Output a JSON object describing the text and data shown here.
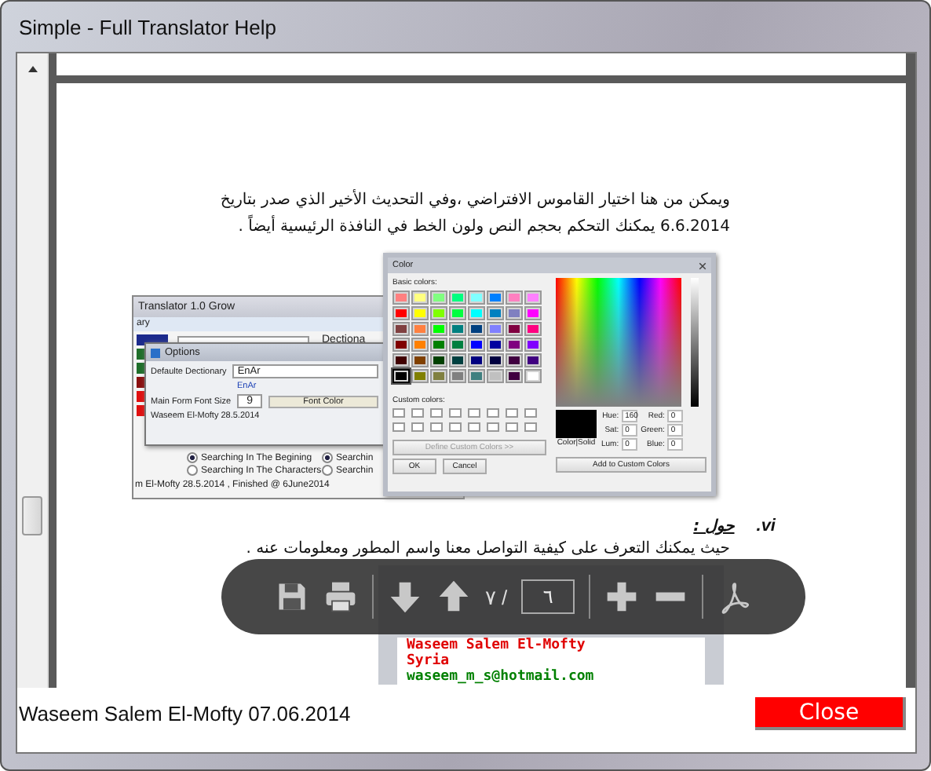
{
  "window": {
    "title": "Simple - Full Translator Help"
  },
  "document": {
    "intro_lines": [
      "ويمكن من هنا اختيار القاموس الافتراضي ،وفي التحديث الأخير الذي صدر بتاريخ",
      "6.6.2014 يمكنك التحكم بحجم النص ولون الخط في النافذة الرئيسية أيضاً ."
    ],
    "screenshot": {
      "main_window": {
        "title": "Translator 1.0 Grow",
        "menu_item": "ary",
        "side_buttons": [
          {
            "color": "#1c2a8c"
          },
          {
            "color": "#1f6e2a"
          },
          {
            "color": "#1f6e2a"
          },
          {
            "color": "#8a1010"
          },
          {
            "color": "#e01010"
          },
          {
            "color": "#e01010"
          }
        ],
        "label": "Dectiona",
        "radios": [
          {
            "label": "Searching In The Begining",
            "selected": true
          },
          {
            "label": "Searchin",
            "selected": true
          },
          {
            "label": "Searching In The Characters",
            "selected": false
          },
          {
            "label": "Searchin",
            "selected": false
          }
        ],
        "status": "m El-Mofty 28.5.2014 , Finished @ 6June2014"
      },
      "options_dialog": {
        "title": "Options",
        "dictionary_label": "Defaulte Dectionary",
        "dictionary_value": "EnAr",
        "dictionary_link": "EnAr",
        "font_size_label": "Main Form Font Size",
        "font_size_value": "9",
        "font_color_button": "Font Color",
        "credit": "Waseem El-Mofty 28.5.2014"
      },
      "color_dialog": {
        "title": "Color",
        "basic_label": "Basic colors:",
        "swatches": [
          {
            "color": "#ff8080",
            "selected": false
          },
          {
            "color": "#ffff80",
            "selected": false
          },
          {
            "color": "#80ff80",
            "selected": false
          },
          {
            "color": "#00ff80",
            "selected": false
          },
          {
            "color": "#80ffff",
            "selected": false
          },
          {
            "color": "#0080ff",
            "selected": false
          },
          {
            "color": "#ff80c0",
            "selected": false
          },
          {
            "color": "#ff80ff",
            "selected": false
          },
          {
            "color": "#ff0000",
            "selected": false
          },
          {
            "color": "#ffff00",
            "selected": false
          },
          {
            "color": "#80ff00",
            "selected": false
          },
          {
            "color": "#00ff40",
            "selected": false
          },
          {
            "color": "#00ffff",
            "selected": false
          },
          {
            "color": "#0080c0",
            "selected": false
          },
          {
            "color": "#8080c0",
            "selected": false
          },
          {
            "color": "#ff00ff",
            "selected": false
          },
          {
            "color": "#804040",
            "selected": false
          },
          {
            "color": "#ff8040",
            "selected": false
          },
          {
            "color": "#00ff00",
            "selected": false
          },
          {
            "color": "#008080",
            "selected": false
          },
          {
            "color": "#004080",
            "selected": false
          },
          {
            "color": "#8080ff",
            "selected": false
          },
          {
            "color": "#800040",
            "selected": false
          },
          {
            "color": "#ff0080",
            "selected": false
          },
          {
            "color": "#800000",
            "selected": false
          },
          {
            "color": "#ff8000",
            "selected": false
          },
          {
            "color": "#008000",
            "selected": false
          },
          {
            "color": "#008040",
            "selected": false
          },
          {
            "color": "#0000ff",
            "selected": false
          },
          {
            "color": "#0000a0",
            "selected": false
          },
          {
            "color": "#800080",
            "selected": false
          },
          {
            "color": "#8000ff",
            "selected": false
          },
          {
            "color": "#400000",
            "selected": false
          },
          {
            "color": "#804000",
            "selected": false
          },
          {
            "color": "#004000",
            "selected": false
          },
          {
            "color": "#004040",
            "selected": false
          },
          {
            "color": "#000080",
            "selected": false
          },
          {
            "color": "#000040",
            "selected": false
          },
          {
            "color": "#400040",
            "selected": false
          },
          {
            "color": "#400080",
            "selected": false
          },
          {
            "color": "#000000",
            "selected": true
          },
          {
            "color": "#808000",
            "selected": false
          },
          {
            "color": "#808040",
            "selected": false
          },
          {
            "color": "#808080",
            "selected": false
          },
          {
            "color": "#408080",
            "selected": false
          },
          {
            "color": "#c0c0c0",
            "selected": false
          },
          {
            "color": "#400040",
            "selected": false
          },
          {
            "color": "#ffffff",
            "selected": false
          }
        ],
        "custom_label": "Custom colors:",
        "define_button": "Define Custom Colors >>",
        "ok_button": "OK",
        "cancel_button": "Cancel",
        "preview_label": "Color|Solid",
        "fields": [
          {
            "label": "Hue:",
            "value": "160"
          },
          {
            "label": "Red:",
            "value": "0"
          },
          {
            "label": "Sat:",
            "value": "0"
          },
          {
            "label": "Green:",
            "value": "0"
          },
          {
            "label": "Lum:",
            "value": "0"
          },
          {
            "label": "Blue:",
            "value": "0"
          }
        ],
        "add_button": "Add to Custom Colors"
      }
    },
    "section": {
      "number": "vi.",
      "title": "حول :",
      "text": "حيث يمكنك التعرف على كيفية التواصل معنا واسم المطور ومعلومات عنه ."
    },
    "about_screenshot": {
      "lines": [
        {
          "text": "Waseem Salem El-Mofty",
          "color": "#e00000"
        },
        {
          "text": "Syria",
          "color": "#e00000"
        },
        {
          "text": "waseem_m_s@hotmail.com",
          "color": "#008000"
        }
      ]
    }
  },
  "pdf_toolbar": {
    "page_count": "٧ /",
    "page_input": "٦"
  },
  "footer": {
    "credit": "Waseem Salem El-Mofty 07.06.2014",
    "close_button": "Close"
  }
}
